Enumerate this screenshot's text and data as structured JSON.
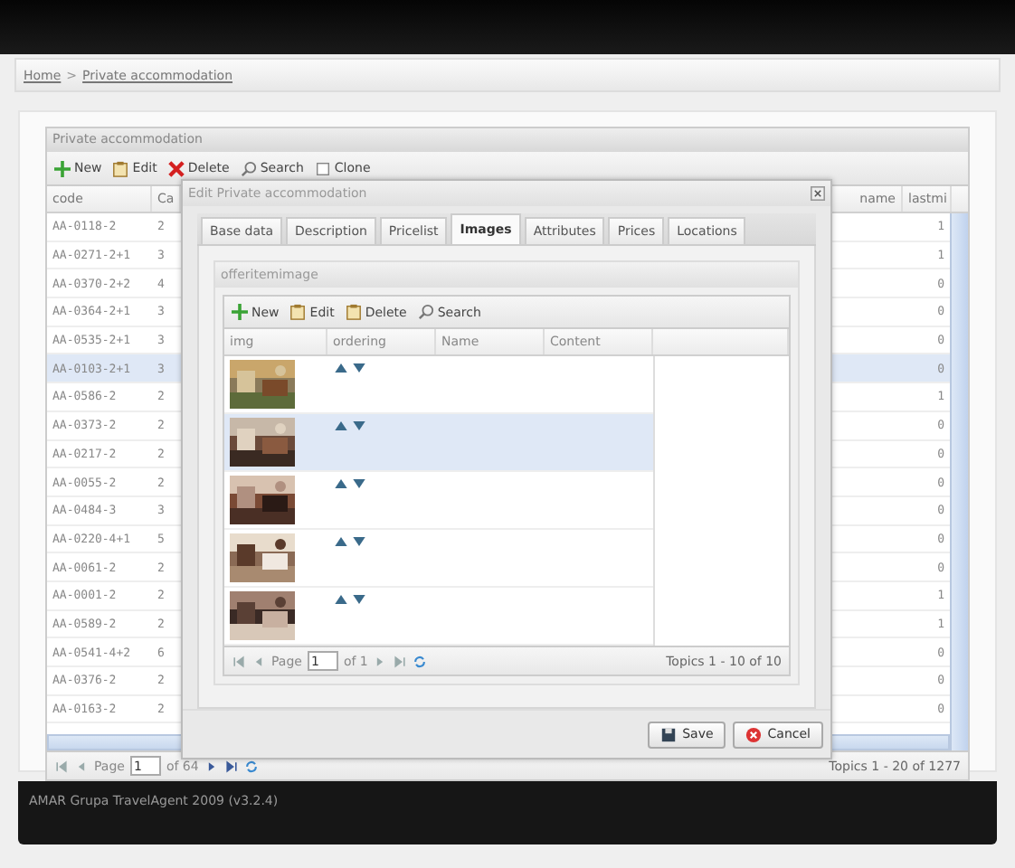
{
  "breadcrumb": {
    "items": [
      "Home",
      "Private accommodation"
    ],
    "separator": ">"
  },
  "grid": {
    "title": "Private accommodation",
    "toolbar": [
      {
        "kind": "new",
        "label": "New"
      },
      {
        "kind": "edit",
        "label": "Edit"
      },
      {
        "kind": "delete",
        "label": "Delete"
      },
      {
        "kind": "search",
        "label": "Search"
      },
      {
        "kind": "clone",
        "label": "Clone"
      }
    ],
    "columns": {
      "code": "code",
      "column_2": "Ca",
      "name": "name",
      "column_4": "lastmi"
    },
    "rows": [
      {
        "code": "AA-0118-2",
        "column_2": "2",
        "column_4": "1",
        "selected": false
      },
      {
        "code": "AA-0271-2+1",
        "column_2": "3",
        "column_4": "1",
        "selected": false
      },
      {
        "code": "AA-0370-2+2",
        "column_2": "4",
        "column_4": "0",
        "selected": false
      },
      {
        "code": "AA-0364-2+1",
        "column_2": "3",
        "column_4": "0",
        "selected": false
      },
      {
        "code": "AA-0535-2+1",
        "column_2": "3",
        "column_4": "0",
        "selected": false
      },
      {
        "code": "AA-0103-2+1",
        "column_2": "3",
        "column_4": "0",
        "selected": true
      },
      {
        "code": "AA-0586-2",
        "column_2": "2",
        "column_4": "1",
        "selected": false
      },
      {
        "code": "AA-0373-2",
        "column_2": "2",
        "column_4": "0",
        "selected": false
      },
      {
        "code": "AA-0217-2",
        "column_2": "2",
        "column_4": "0",
        "selected": false
      },
      {
        "code": "AA-0055-2",
        "column_2": "2",
        "column_4": "0",
        "selected": false
      },
      {
        "code": "AA-0484-3",
        "column_2": "3",
        "column_4": "0",
        "selected": false
      },
      {
        "code": "AA-0220-4+1",
        "column_2": "5",
        "column_4": "0",
        "selected": false
      },
      {
        "code": "AA-0061-2",
        "column_2": "2",
        "column_4": "0",
        "selected": false
      },
      {
        "code": "AA-0001-2",
        "column_2": "2",
        "column_4": "1",
        "selected": false
      },
      {
        "code": "AA-0589-2",
        "column_2": "2",
        "column_4": "1",
        "selected": false
      },
      {
        "code": "AA-0541-4+2",
        "column_2": "6",
        "column_4": "0",
        "selected": false
      },
      {
        "code": "AA-0376-2",
        "column_2": "2",
        "column_4": "0",
        "selected": false
      },
      {
        "code": "AA-0163-2",
        "column_2": "2",
        "column_4": "0",
        "selected": false
      }
    ],
    "paging": {
      "page_label": "Page",
      "page": "1",
      "of": "of 64",
      "topics": "Topics 1 - 20 of 1277"
    }
  },
  "dialog": {
    "title": "Edit Private accommodation",
    "tabs": [
      {
        "label": "Base data",
        "selected": false
      },
      {
        "label": "Description",
        "selected": false
      },
      {
        "label": "Pricelist",
        "selected": false
      },
      {
        "label": "Images",
        "selected": true
      },
      {
        "label": "Attributes",
        "selected": false
      },
      {
        "label": "Prices",
        "selected": false
      },
      {
        "label": "Locations",
        "selected": false
      }
    ],
    "panel_title": "offeritemimage",
    "toolbar": [
      {
        "kind": "new",
        "label": "New"
      },
      {
        "kind": "edit",
        "label": "Edit"
      },
      {
        "kind": "edit",
        "label": "Delete"
      },
      {
        "kind": "search",
        "label": "Search"
      }
    ],
    "columns": [
      "img",
      "ordering",
      "Name",
      "Content"
    ],
    "rows": [
      {
        "kind": "picture",
        "selected": false
      },
      {
        "kind": "picture",
        "selected": true
      },
      {
        "kind": "picture",
        "selected": false
      },
      {
        "kind": "picture",
        "selected": false
      },
      {
        "kind": "picture",
        "selected": false
      }
    ],
    "paging": {
      "page_label": "Page",
      "page": "1",
      "of": "of 1",
      "topics": "Topics 1 - 10 of 10"
    },
    "buttons": [
      {
        "kind": "save",
        "label": "Save"
      },
      {
        "kind": "cancel",
        "label": "Cancel"
      }
    ]
  },
  "footer": "AMAR Grupa TravelAgent 2009 (v3.2.4)"
}
